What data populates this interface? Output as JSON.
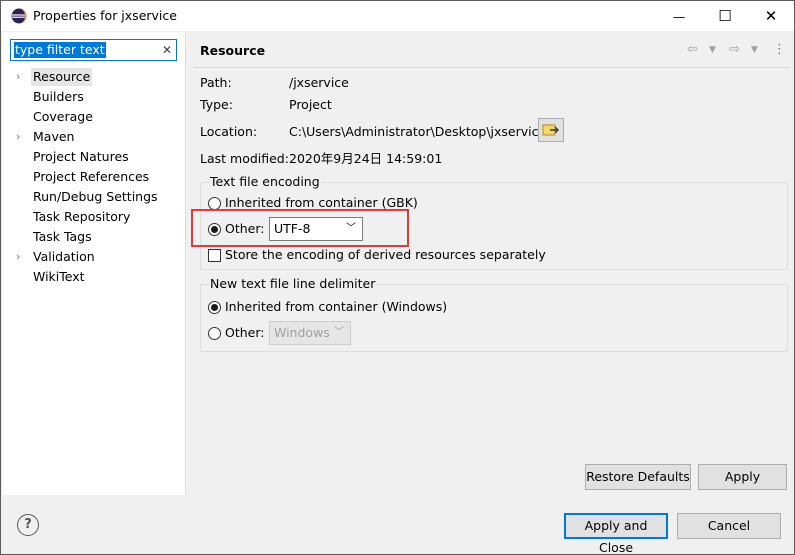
{
  "window": {
    "title": "Properties for jxservice",
    "minimize_glyph": "—",
    "maximize_glyph": "☐",
    "close_glyph": "✕"
  },
  "filter": {
    "value": "type filter text",
    "clear_glyph": "✕"
  },
  "tree": {
    "items": [
      {
        "label": "Resource",
        "expandable": true,
        "selected": true
      },
      {
        "label": "Builders",
        "expandable": false
      },
      {
        "label": "Coverage",
        "expandable": false
      },
      {
        "label": "Maven",
        "expandable": true
      },
      {
        "label": "Project Natures",
        "expandable": false
      },
      {
        "label": "Project References",
        "expandable": false
      },
      {
        "label": "Run/Debug Settings",
        "expandable": false
      },
      {
        "label": "Task Repository",
        "expandable": false
      },
      {
        "label": "Task Tags",
        "expandable": false
      },
      {
        "label": "Validation",
        "expandable": true
      },
      {
        "label": "WikiText",
        "expandable": false
      }
    ]
  },
  "resource": {
    "header": "Resource",
    "path_label": "Path:",
    "path_value": "/jxservice",
    "type_label": "Type:",
    "type_value": "Project",
    "location_label": "Location:",
    "location_value": "C:\\Users\\Administrator\\Desktop\\jxservice",
    "modified_label": "Last modified:",
    "modified_value": "2020年9月24日 14:59:01"
  },
  "encoding": {
    "group_title": "Text file encoding",
    "inherited_label": "Inherited from container (GBK)",
    "other_label": "Other:",
    "other_value": "UTF-8",
    "store_label": "Store the encoding of derived resources separately"
  },
  "delimiter": {
    "group_title": "New text file line delimiter",
    "inherited_label": "Inherited from container (Windows)",
    "other_label": "Other:",
    "other_value": "Windows"
  },
  "buttons": {
    "restore_defaults": "Restore Defaults",
    "apply": "Apply",
    "apply_and_close": "Apply and Close",
    "cancel": "Cancel",
    "help": "?"
  },
  "colors": {
    "accent": "#0078d7",
    "highlight_box": "#e53935"
  }
}
